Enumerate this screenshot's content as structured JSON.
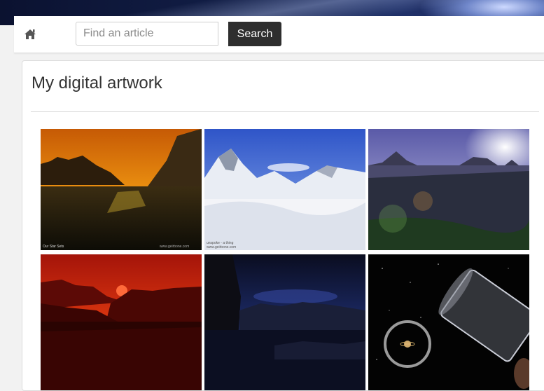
{
  "navbar": {
    "home_icon": "home-icon",
    "search": {
      "placeholder": "Find an article",
      "value": "",
      "button_label": "Search"
    }
  },
  "page": {
    "title": "My digital artwork"
  },
  "gallery": {
    "items": [
      {
        "subject": "sunset over water between cliffs",
        "caption_left": "Our Star Sets",
        "caption_right": "www.geirbone.com"
      },
      {
        "subject": "snowy mountains under blue sky",
        "caption_left": "unspoke - a thing",
        "caption_right": "www.geirbone.com"
      },
      {
        "subject": "misty lake with distant islands and lens flare"
      },
      {
        "subject": "red sky over rocky coast"
      },
      {
        "subject": "dark blue night cliff and water"
      },
      {
        "subject": "telescope in space with planet"
      }
    ]
  },
  "colors": {
    "search_button": "#2e2e2e",
    "page_background": "#f2f2f2"
  }
}
